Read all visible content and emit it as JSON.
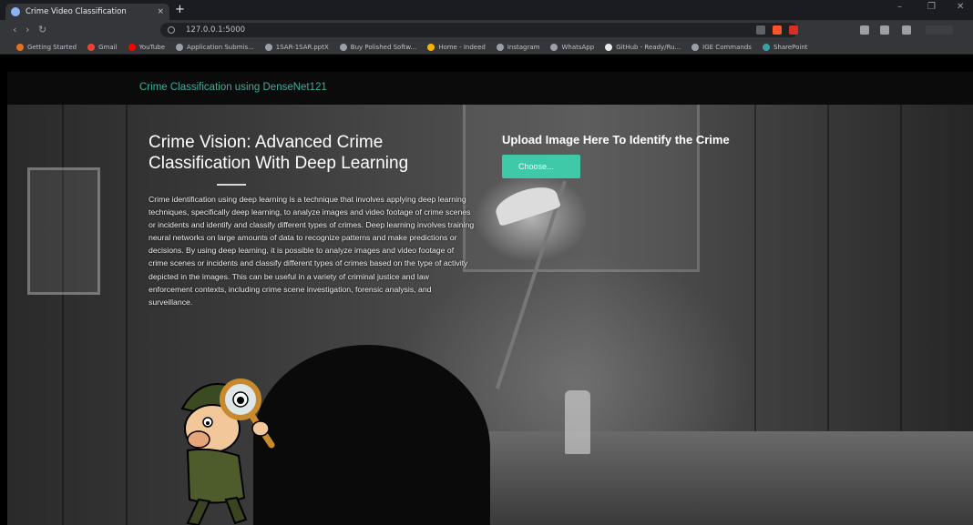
{
  "browser": {
    "tab_title": "Crime Video Classification",
    "tab_close": "×",
    "new_tab": "+",
    "url": "127.0.0.1:5000",
    "window_controls": [
      "–",
      "❐",
      "✕"
    ],
    "nav": {
      "back": "‹",
      "forward": "›",
      "reload": "↻"
    }
  },
  "bookmarks": [
    {
      "label": "Getting Started",
      "color": "#e8711a"
    },
    {
      "label": "Gmail",
      "color": "#ea4335"
    },
    {
      "label": "YouTube",
      "color": "#ff0000"
    },
    {
      "label": "Application Submis...",
      "color": "#9aa0a6"
    },
    {
      "label": "1SAR-1SAR.pptX",
      "color": "#9aa0a6"
    },
    {
      "label": "Buy Polished Softw...",
      "color": "#9aa0a6"
    },
    {
      "label": "Home - Indeed",
      "color": "#f4b400"
    },
    {
      "label": "Instagram",
      "color": "#9aa0a6"
    },
    {
      "label": "WhatsApp",
      "color": "#9aa0a6"
    },
    {
      "label": "GitHub - Ready/Ru...",
      "color": "#e8eaed"
    },
    {
      "label": "IGE Commands",
      "color": "#9aa0a6"
    },
    {
      "label": "SharePoint",
      "color": "#3aa0a6"
    }
  ],
  "site": {
    "title": "Crime Classification using DenseNet121",
    "hero_heading": "Crime Vision: Advanced Crime Classification With Deep Learning",
    "hero_body": "Crime identification using deep learning is a technique that involves applying deep learning techniques, specifically deep learning, to analyze images and video footage of crime scenes or incidents and identify and classify different types of crimes. Deep learning involves training neural networks on large amounts of data to recognize patterns and make predictions or decisions. By using deep learning, it is possible to analyze images and video footage of crime scenes or incidents and classify different types of crimes based on the type of activity depicted in the images. This can be useful in a variety of criminal justice and law enforcement contexts, including crime scene investigation, forensic analysis, and surveillance.",
    "upload_heading": "Upload Image Here To Identify the Crime",
    "choose_label": "Choose..."
  },
  "colors": {
    "accent": "#3fc9a8",
    "title_accent": "#3fae9a"
  }
}
